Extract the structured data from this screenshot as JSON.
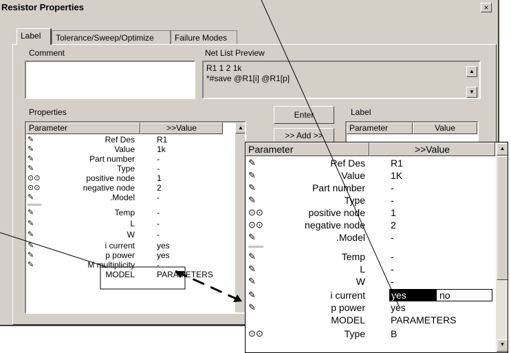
{
  "window": {
    "title": "Resistor Properties",
    "close_label": "×"
  },
  "tabs": [
    {
      "label": "Label"
    },
    {
      "label": "Tolerance/Sweep/Optimize"
    },
    {
      "label": "Failure Modes"
    }
  ],
  "comment": {
    "label": "Comment",
    "value": ""
  },
  "netlist": {
    "label": "Net List Preview",
    "line1": "R1 1 2 1k",
    "line2": "*#save  @R1[i] @R1[p]"
  },
  "properties": {
    "label": "Properties",
    "col_param": "Parameter",
    "col_value": ">>Value",
    "rows": [
      {
        "icon": "pencil",
        "name": "Ref Des",
        "value": "R1"
      },
      {
        "icon": "pencil",
        "name": "Value",
        "value": "1k"
      },
      {
        "icon": "pencil",
        "name": "Part number",
        "value": "-"
      },
      {
        "icon": "pencil",
        "name": "Type",
        "value": "-"
      },
      {
        "icon": "glasses",
        "name": "positive node",
        "value": "1"
      },
      {
        "icon": "glasses",
        "name": "negative node",
        "value": "2"
      },
      {
        "icon": "pencil",
        "name": ".Model",
        "value": "-"
      },
      {
        "icon": "pencil",
        "name": "Temp",
        "value": "-"
      },
      {
        "icon": "pencil",
        "name": "L",
        "value": "-"
      },
      {
        "icon": "pencil",
        "name": "W",
        "value": "-"
      },
      {
        "icon": "pencil",
        "name": "i current",
        "value": "yes"
      },
      {
        "icon": "pencil",
        "name": "p power",
        "value": "yes"
      },
      {
        "icon": "pencil",
        "name": "M multiplicity",
        "value": "-"
      },
      {
        "icon": "",
        "name": "MODEL",
        "value": "PARAMETERS"
      }
    ]
  },
  "buttons": {
    "enter": "Enter",
    "add": ">> Add >>"
  },
  "label_panel": {
    "label": "Label",
    "col_param": "Parameter",
    "col_value": "Value"
  },
  "zoom": {
    "col_param": "Parameter",
    "col_value": ">>Value",
    "rows": [
      {
        "icon": "pencil",
        "name": "Ref Des",
        "value": "R1"
      },
      {
        "icon": "pencil",
        "name": "Value",
        "value": "1K"
      },
      {
        "icon": "pencil",
        "name": "Part number",
        "value": "-"
      },
      {
        "icon": "pencil",
        "name": "Type",
        "value": "-"
      },
      {
        "icon": "glasses",
        "name": "positive node",
        "value": "1"
      },
      {
        "icon": "glasses",
        "name": "negative node",
        "value": "2"
      },
      {
        "icon": "pencil",
        "name": ".Model",
        "value": "-"
      },
      {
        "icon": "pencil",
        "name": "Temp",
        "value": "-"
      },
      {
        "icon": "pencil",
        "name": "L",
        "value": "-"
      },
      {
        "icon": "pencil",
        "name": "W",
        "value": "-"
      },
      {
        "icon": "pencil",
        "name": "i current",
        "value": "yes",
        "dropdown_selected": "yes",
        "dropdown_other": "no"
      },
      {
        "icon": "pencil",
        "name": "p power",
        "value": "yes"
      },
      {
        "icon": "",
        "name": "MODEL",
        "value": "PARAMETERS"
      },
      {
        "icon": "glasses",
        "name": "Type",
        "value": "B"
      }
    ]
  }
}
